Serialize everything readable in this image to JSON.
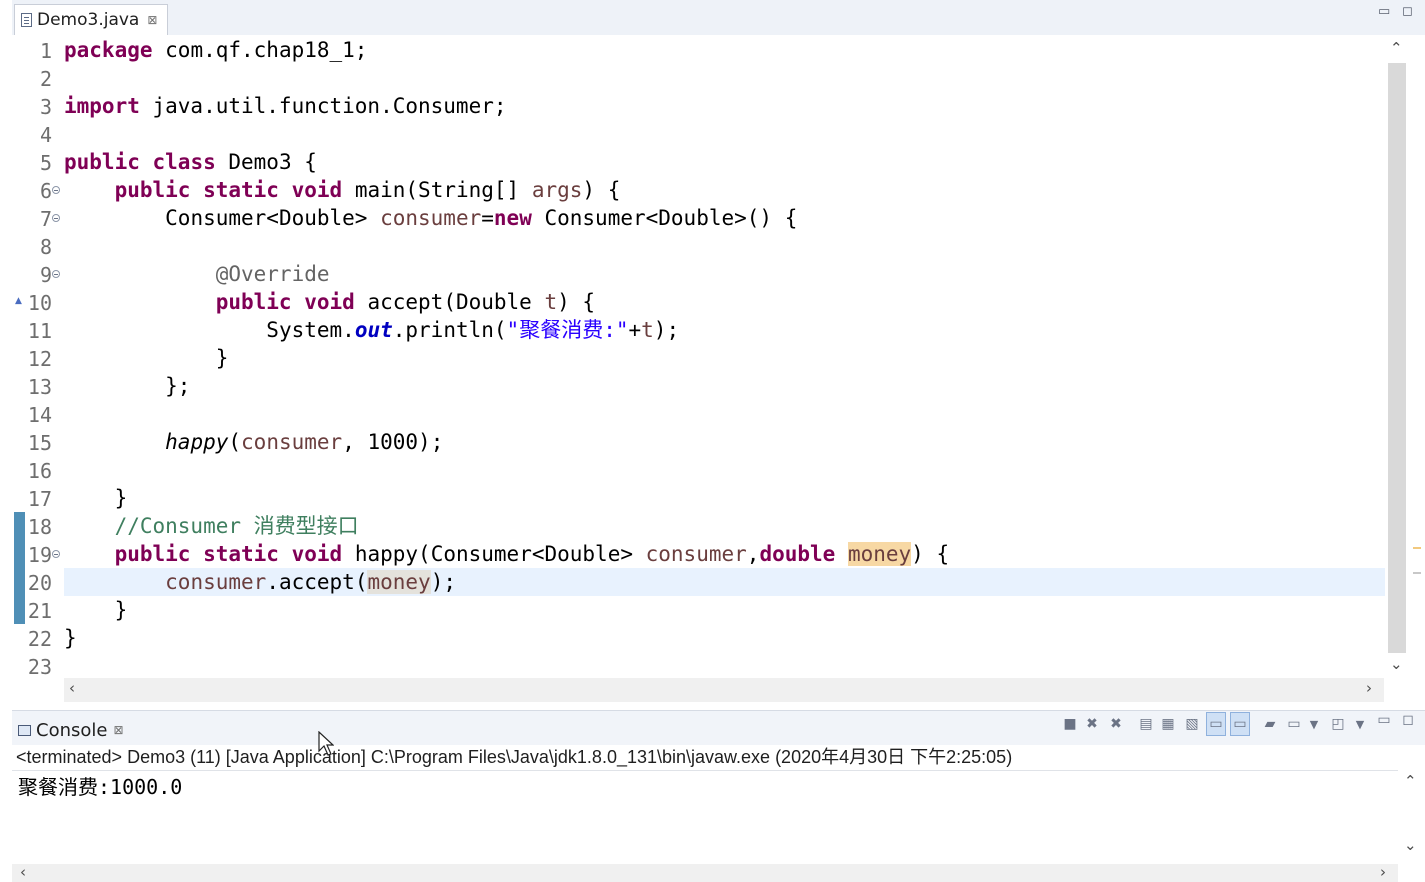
{
  "editor": {
    "tab_label": "Demo3.java",
    "tab_close": "⊠",
    "minimize": "▭",
    "maximize": "◻"
  },
  "line_numbers": [
    "1",
    "2",
    "3",
    "4",
    "5",
    "6",
    "7",
    "8",
    "9",
    "10",
    "11",
    "12",
    "13",
    "14",
    "15",
    "16",
    "17",
    "18",
    "19",
    "20",
    "21",
    "22",
    "23"
  ],
  "code": {
    "l1_kw": "package",
    "l1_rest": " com.qf.chap18_1;",
    "l3_kw": "import",
    "l3_rest": " java.util.function.Consumer;",
    "l5_kw1": "public",
    "l5_kw2": "class",
    "l5_rest": " Demo3 {",
    "l6_kw1": "public",
    "l6_kw2": "static",
    "l6_kw3": "void",
    "l6_a": " main(String[] ",
    "l6_var": "args",
    "l6_b": ") {",
    "l7_a": "Consumer<Double> ",
    "l7_var": "consumer",
    "l7_b": "=",
    "l7_kw": "new",
    "l7_c": " Consumer<Double>() {",
    "l9_ann": "@Override",
    "l10_kw1": "public",
    "l10_kw2": "void",
    "l10_a": " accept(Double ",
    "l10_var": "t",
    "l10_b": ") {",
    "l11_a": "System.",
    "l11_field": "out",
    "l11_b": ".println(",
    "l11_str": "\"聚餐消费:\"",
    "l11_c": "+",
    "l11_var": "t",
    "l11_d": ");",
    "l12": "}",
    "l13": "};",
    "l15_call": "happy",
    "l15_a": "(",
    "l15_var": "consumer",
    "l15_b": ", 1000);",
    "l17": "}",
    "l18_cmt": "//Consumer 消费型接口",
    "l19_kw1": "public",
    "l19_kw2": "static",
    "l19_kw3": "void",
    "l19_a": " happy(Consumer<Double> ",
    "l19_var1": "consumer",
    "l19_b": ",",
    "l19_kw4": "double",
    "l19_var2": "money",
    "l19_c": ") {",
    "l20_var1": "consumer",
    "l20_a": ".accept(",
    "l20_var2": "money",
    "l20_b": ");",
    "l21": "}",
    "l22": "}"
  },
  "console": {
    "tab_label": "Console",
    "tab_close": "⊠",
    "status": "<terminated> Demo3 (11) [Java Application] C:\\Program Files\\Java\\jdk1.8.0_131\\bin\\javaw.exe (2020年4月30日 下午2:25:05)",
    "output": "聚餐消费:1000.0"
  },
  "toolbar_icons": [
    "stop-icon",
    "remove-launch-icon",
    "remove-all-terminated-icon",
    "clear-console-icon",
    "scroll-lock-icon",
    "word-wrap-icon",
    "show-on-stdout-icon",
    "show-on-stderr-icon",
    "pin-console-icon",
    "display-console-icon",
    "display-dropdown-icon",
    "open-console-icon",
    "open-console-dropdown-icon",
    "minimize-icon",
    "maximize-icon"
  ],
  "colors": {
    "keyword": "#7f0055",
    "variable": "#6a3e3e",
    "field": "#0000c0",
    "string": "#2a00ff",
    "comment": "#3f7f5f",
    "current_line": "#e8f2fe",
    "occurrence": "#f7d8a4"
  }
}
